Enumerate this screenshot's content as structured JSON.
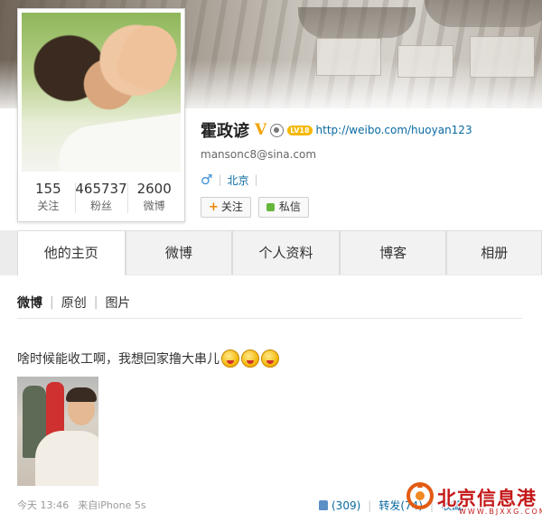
{
  "profile": {
    "name": "霍政谚",
    "verified_badge": "V",
    "level_badge": "LV18",
    "weibo_url": "http://weibo.com/huoyan123",
    "email": "mansonc8@sina.com",
    "gender_icon": "♂",
    "location": "北京",
    "follow_label": "关注",
    "message_label": "私信",
    "stats": [
      {
        "value": "155",
        "label": "关注"
      },
      {
        "value": "465737",
        "label": "粉丝"
      },
      {
        "value": "2600",
        "label": "微博"
      }
    ]
  },
  "tabs": [
    {
      "label": "他的主页",
      "active": true
    },
    {
      "label": "微博",
      "active": false
    },
    {
      "label": "个人资料",
      "active": false
    },
    {
      "label": "博客",
      "active": false
    },
    {
      "label": "相册",
      "active": false
    }
  ],
  "subnav": {
    "items": [
      "微博",
      "原创",
      "图片"
    ],
    "separator": "|"
  },
  "post": {
    "text": "啥时候能收工啊，我想回家撸大串儿",
    "emoji_count": 3,
    "time": "今天 13:46",
    "source": "来自iPhone 5s",
    "likes": "(309)",
    "repost": "转发(74)",
    "comment": "收藏"
  },
  "watermark": {
    "text": "北京信息港",
    "url": "WWW.BJXXG.COM"
  },
  "colors": {
    "link": "#0a6aa1",
    "verified": "#f2a200",
    "watermark": "#c41818"
  }
}
